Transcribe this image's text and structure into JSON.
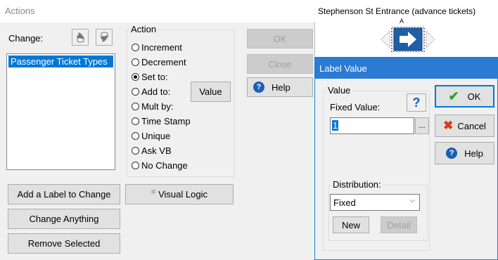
{
  "actions_window": {
    "title": "Actions",
    "change_label": "Change:",
    "change_list": [
      "Passenger Ticket Types"
    ],
    "action_group_title": "Action",
    "action_options": [
      {
        "label": "Increment",
        "selected": false
      },
      {
        "label": "Decrement",
        "selected": false
      },
      {
        "label": "Set to:",
        "selected": true
      },
      {
        "label": "Add to:",
        "selected": false
      },
      {
        "label": "Mult by:",
        "selected": false
      },
      {
        "label": "Time Stamp",
        "selected": false
      },
      {
        "label": "Unique",
        "selected": false
      },
      {
        "label": "Ask VB",
        "selected": false
      },
      {
        "label": "No Change",
        "selected": false
      }
    ],
    "value_button": "Value",
    "ok_button": "OK",
    "close_button": "Close",
    "help_button": "Help",
    "add_label_button": "Add a Label to Change",
    "visual_logic_prefix": "IF",
    "visual_logic_button": "Visual Logic",
    "change_anything_button": "Change Anything",
    "remove_selected_button": "Remove Selected"
  },
  "canvas": {
    "entrance_label": "Stephenson St Entrance (advance tickets)",
    "node_marker": "A"
  },
  "label_value_dialog": {
    "title": "Label Value",
    "value_group_title": "Value",
    "fixed_value_label": "Fixed Value:",
    "fixed_value": "1",
    "browse_button": "...",
    "distribution_group_title": "Distribution:",
    "distribution_selected": "Fixed",
    "new_button": "New",
    "detail_button": "Detail",
    "ok_button": "OK",
    "cancel_button": "Cancel",
    "help_button": "Help"
  }
}
